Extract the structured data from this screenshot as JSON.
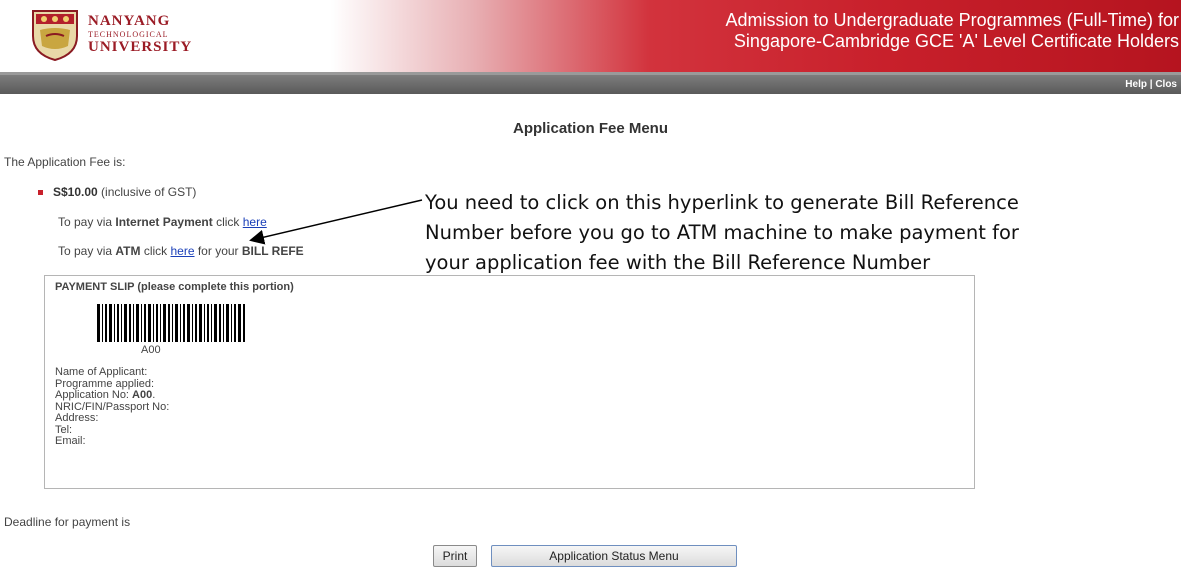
{
  "header": {
    "logo_line1": "NANYANG",
    "logo_line2": "TECHNOLOGICAL",
    "logo_line3": "UNIVERSITY",
    "title_line1": "Admission to Undergraduate Programmes (Full-Time) for",
    "title_line2": "Singapore-Cambridge GCE 'A' Level Certificate Holders"
  },
  "toolbar": {
    "help": "Help",
    "separator": " | ",
    "close": "Clos"
  },
  "page": {
    "title": "Application Fee Menu",
    "fee_intro": "The Application Fee is:",
    "fee_amount": "S$10.00",
    "fee_note": " (inclusive of GST)",
    "internet_prefix": "To pay via ",
    "internet_bold": "Internet Payment",
    "internet_mid": " click ",
    "internet_link": "here",
    "atm_prefix": "To pay via ",
    "atm_bold": "ATM",
    "atm_mid": " click ",
    "atm_link": "here",
    "atm_suffix": " for your ",
    "atm_suffix_bold": "BILL REFE"
  },
  "annotation": {
    "line1": "You need to click on this hyperlink to generate Bill Reference",
    "line2": "Number before you go to ATM machine to make payment for",
    "line3": "your application fee with the Bill Reference Number"
  },
  "slip": {
    "title": "PAYMENT SLIP (please complete this portion)",
    "barcode_label": "A00",
    "name_label": "Name of Applicant:",
    "programme_label": "Programme applied:",
    "appno_label": "Application No: ",
    "appno_value": "A00",
    "appno_suffix": ".",
    "nric_label": "NRIC/FIN/Passport No:",
    "address_label": "Address:",
    "tel_label": "Tel:",
    "email_label": "Email:"
  },
  "footer": {
    "deadline": "Deadline for payment is",
    "print_button": "Print",
    "status_button": "Application Status Menu"
  },
  "colors": {
    "header_red": "#c8202b",
    "link_blue": "#1a3fb8",
    "toolbar_gray": "#6a6a6a"
  }
}
